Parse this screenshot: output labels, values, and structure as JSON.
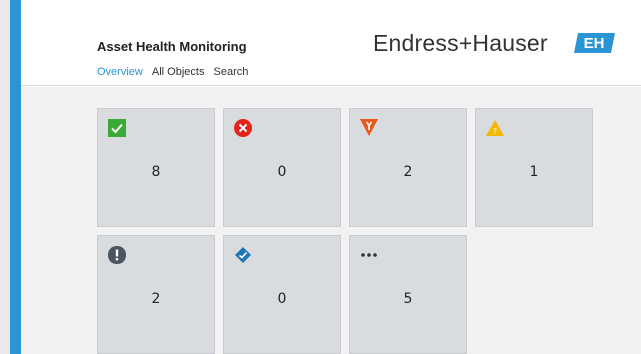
{
  "header": {
    "app_title": "Asset Health Monitoring",
    "nav": {
      "overview": "Overview",
      "all_objects": "All Objects",
      "search": "Search"
    },
    "brand_name": "Endress+Hauser",
    "brand_logo": "EH",
    "accent_color": "#2a95d4"
  },
  "tiles": [
    {
      "icon": "check-icon",
      "count": "8",
      "color": "#3aa935"
    },
    {
      "icon": "error-icon",
      "count": "0",
      "color": "#e1251b"
    },
    {
      "icon": "maintenance-icon",
      "count": "2",
      "color": "#e8581a"
    },
    {
      "icon": "warning-icon",
      "count": "1",
      "color": "#f5b800"
    },
    {
      "icon": "exclamation-icon",
      "count": "2",
      "color": "#4a5560"
    },
    {
      "icon": "check-function-icon",
      "count": "0",
      "color": "#1f78b4"
    },
    {
      "icon": "more-icon",
      "count": "5",
      "color": "#333333"
    }
  ]
}
